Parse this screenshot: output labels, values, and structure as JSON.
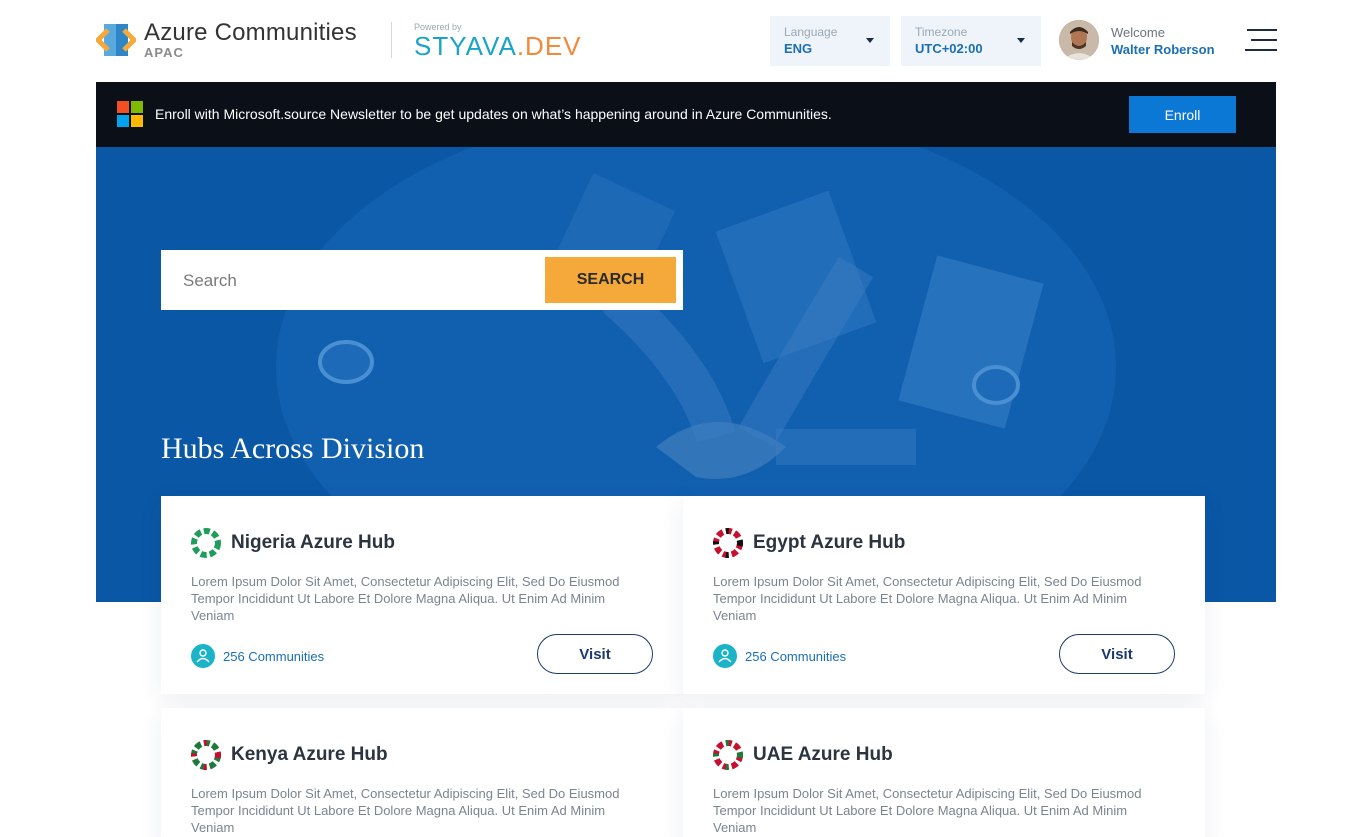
{
  "header": {
    "logo_title": "Azure Communities",
    "logo_sub": "APAC",
    "powered_label": "Powered by",
    "powered_brand_a": "STYAVA",
    "powered_brand_b": ".DEV",
    "language": {
      "label": "Language",
      "value": "ENG"
    },
    "timezone": {
      "label": "Timezone",
      "value": "UTC+02:00"
    },
    "welcome_label": "Welcome",
    "user_name": "Walter Roberson"
  },
  "enroll": {
    "text": "Enroll with Microsoft.source Newsletter to be get updates on what’s happening around in Azure Communities.",
    "button": "Enroll"
  },
  "search": {
    "placeholder": "Search",
    "button": "SEARCH"
  },
  "section_title": "Hubs Across Division",
  "hubs": [
    {
      "name": "Nigeria Azure Hub",
      "description": "Lorem Ipsum Dolor Sit Amet, Consectetur Adipiscing Elit, Sed Do Eiusmod Tempor Incididunt Ut Labore Et Dolore Magna Aliqua. Ut Enim Ad Minim Veniam",
      "communities": "256 Communities",
      "visit": "Visit"
    },
    {
      "name": "Egypt Azure Hub",
      "description": "Lorem Ipsum Dolor Sit Amet, Consectetur Adipiscing Elit, Sed Do Eiusmod Tempor Incididunt Ut Labore Et Dolore Magna Aliqua. Ut Enim Ad Minim Veniam",
      "communities": "256 Communities",
      "visit": "Visit"
    },
    {
      "name": "Kenya Azure Hub",
      "description": "Lorem Ipsum Dolor Sit Amet, Consectetur Adipiscing Elit, Sed Do Eiusmod Tempor Incididunt Ut Labore Et Dolore Magna Aliqua. Ut Enim Ad Minim Veniam"
    },
    {
      "name": "UAE Azure Hub",
      "description": "Lorem Ipsum Dolor Sit Amet, Consectetur Adipiscing Elit, Sed Do Eiusmod Tempor Incididunt Ut Labore Et Dolore Magna Aliqua. Ut Enim Ad Minim Veniam"
    }
  ],
  "colors": {
    "brand_blue": "#0a57a6",
    "accent_orange": "#f5a93b",
    "enroll_blue": "#0b78d6",
    "nigeria": "#1e9e5a",
    "egypt": "#c8102e",
    "kenya": "#1e7a3a",
    "uae": "#c8102e"
  },
  "icons": {
    "logo": "azure-communities-logo",
    "microsoft": "microsoft-logo",
    "menu": "hamburger-menu-icon",
    "communities": "people-icon"
  }
}
